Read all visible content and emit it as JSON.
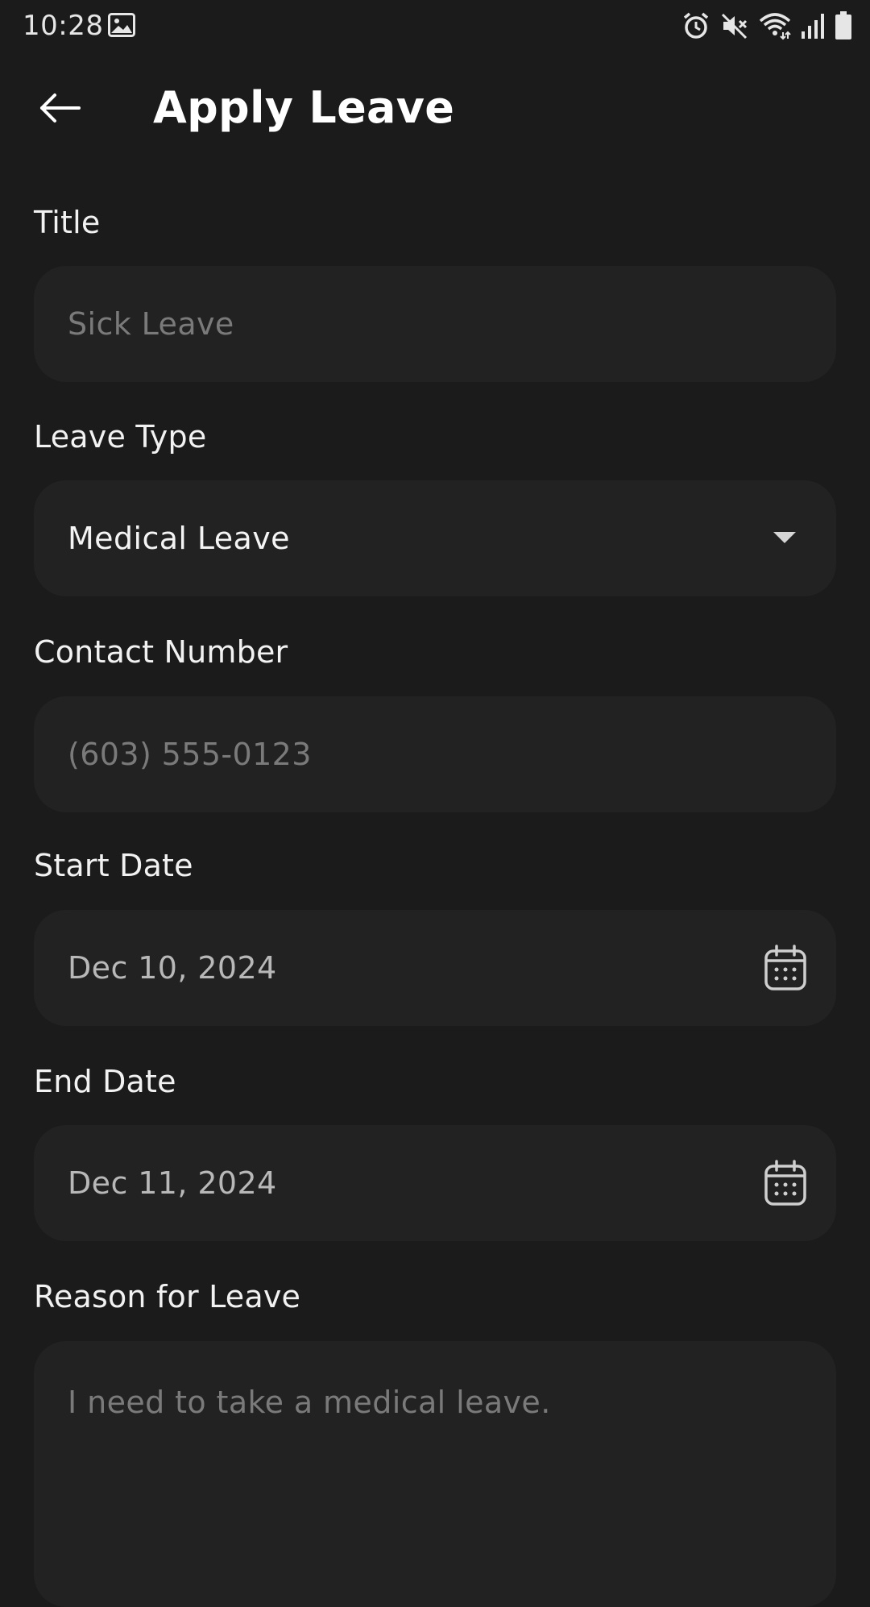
{
  "status_bar": {
    "time": "10:28",
    "icons": [
      "gallery-icon",
      "alarm-icon",
      "mute-icon",
      "wifi-icon",
      "signal-icon",
      "battery-icon"
    ]
  },
  "app_bar": {
    "title": "Apply Leave",
    "back_icon": "arrow-left-icon"
  },
  "form": {
    "title": {
      "label": "Title",
      "placeholder": "Sick Leave"
    },
    "leave_type": {
      "label": "Leave Type",
      "value": "Medical Leave",
      "icon": "dropdown-arrow-icon"
    },
    "contact_number": {
      "label": "Contact Number",
      "placeholder": "(603) 555-0123"
    },
    "start_date": {
      "label": "Start Date",
      "value": "Dec 10, 2024",
      "icon": "calendar-icon"
    },
    "end_date": {
      "label": "End Date",
      "value": "Dec 11, 2024",
      "icon": "calendar-icon"
    },
    "reason": {
      "label": "Reason for Leave",
      "placeholder": "I need to take a medical leave."
    }
  },
  "colors": {
    "background": "#1b1b1b",
    "field_background": "#222222",
    "placeholder": "#7a7a7a",
    "text": "#ffffff"
  }
}
